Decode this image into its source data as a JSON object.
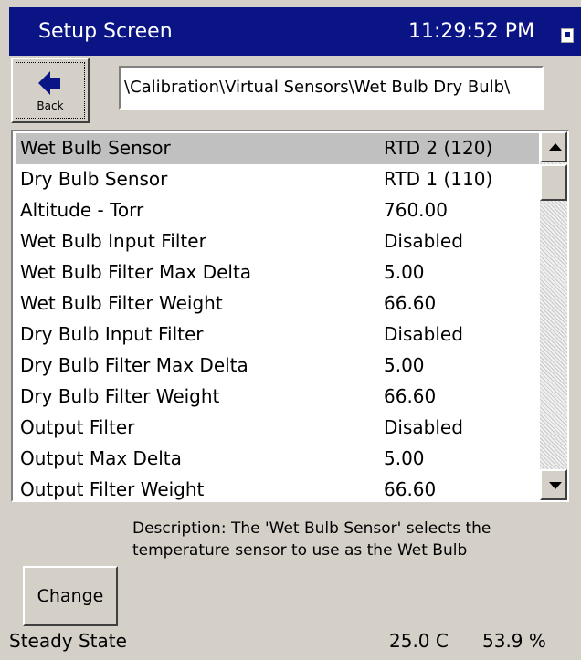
{
  "titlebar": {
    "title": "Setup Screen",
    "time": "11:29:52 PM"
  },
  "back_button": {
    "label": "Back"
  },
  "path": "\\Calibration\\Virtual Sensors\\Wet Bulb Dry Bulb\\",
  "settings": [
    {
      "name": "Wet Bulb Sensor",
      "value": "RTD 2 (120)"
    },
    {
      "name": "Dry Bulb Sensor",
      "value": "RTD 1 (110)"
    },
    {
      "name": "Altitude - Torr",
      "value": "760.00"
    },
    {
      "name": "Wet Bulb Input Filter",
      "value": "Disabled"
    },
    {
      "name": "Wet Bulb Filter Max Delta",
      "value": "5.00"
    },
    {
      "name": "Wet Bulb Filter Weight",
      "value": "66.60"
    },
    {
      "name": "Dry Bulb Input Filter",
      "value": "Disabled"
    },
    {
      "name": "Dry Bulb Filter Max Delta",
      "value": "5.00"
    },
    {
      "name": "Dry Bulb Filter Weight",
      "value": "66.60"
    },
    {
      "name": "Output Filter",
      "value": "Disabled"
    },
    {
      "name": "Output Max Delta",
      "value": "5.00"
    },
    {
      "name": "Output Filter Weight",
      "value": "66.60"
    }
  ],
  "description": {
    "line1": "Description:  The 'Wet Bulb Sensor' selects the",
    "line2": "temperature sensor to use as the Wet Bulb"
  },
  "change_button": {
    "label": "Change"
  },
  "status": {
    "state": "Steady State",
    "temperature": "25.0 C",
    "humidity": "53.9 %"
  },
  "colors": {
    "titlebar_bg": "#0a1484",
    "window_bg": "#d4d0c8",
    "selection_bg": "#c0c0c0"
  }
}
